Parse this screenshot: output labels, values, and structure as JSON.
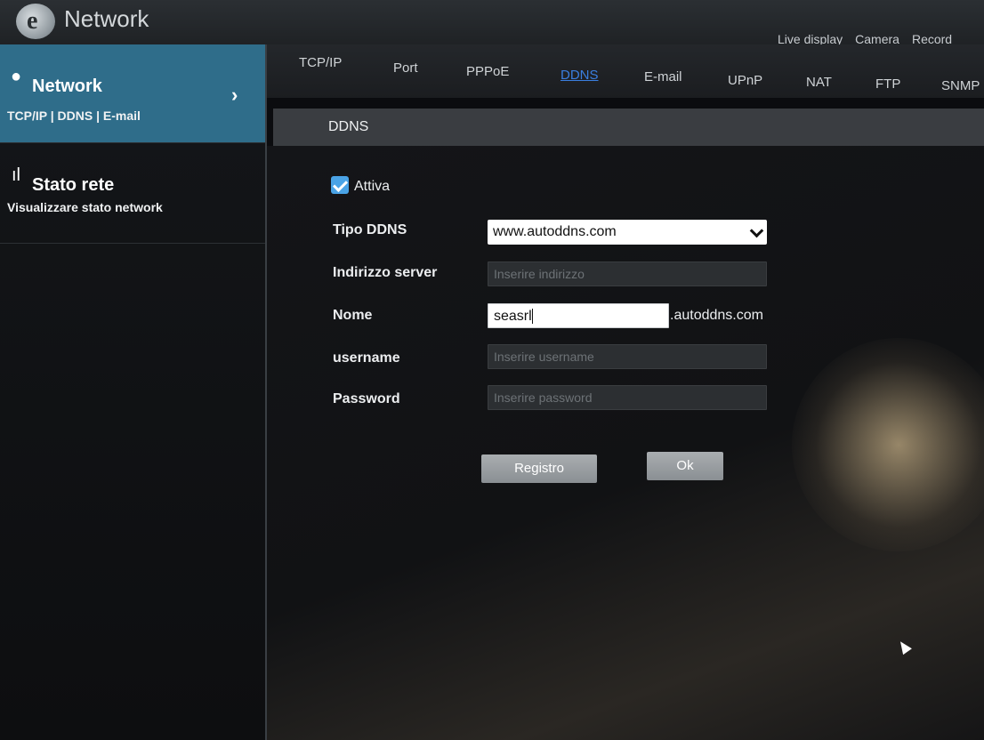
{
  "app": {
    "title": "Network"
  },
  "top_nav": [
    "Live display",
    "Camera",
    "Record"
  ],
  "sidebar": {
    "items": [
      {
        "title": "Network",
        "subtitle": "TCP/IP | DDNS | E-mail"
      },
      {
        "title": "Stato rete",
        "subtitle": "Visualizzare stato network"
      }
    ]
  },
  "tabs": [
    "TCP/IP",
    "Port",
    "PPPoE",
    "DDNS",
    "E-mail",
    "UPnP",
    "NAT",
    "FTP",
    "SNMP"
  ],
  "active_tab": "DDNS",
  "section": {
    "title": "DDNS"
  },
  "form": {
    "enable_label": "Attiva",
    "enabled": true,
    "ddns_type_label": "Tipo DDNS",
    "ddns_type_value": "www.autoddns.com",
    "server_label": "Indirizzo server",
    "server_placeholder": "Inserire indirizzo",
    "name_label": "Nome",
    "name_value": "seasrl",
    "name_suffix": ".autoddns.com",
    "username_label": "username",
    "username_placeholder": "Inserire username",
    "password_label": "Password",
    "password_placeholder": "Inserire password"
  },
  "buttons": {
    "register": "Registro",
    "ok": "Ok"
  },
  "colors": {
    "accent": "#2f6d8a",
    "active_tab": "#3a7fe0",
    "checkbox": "#4aa3e6"
  }
}
